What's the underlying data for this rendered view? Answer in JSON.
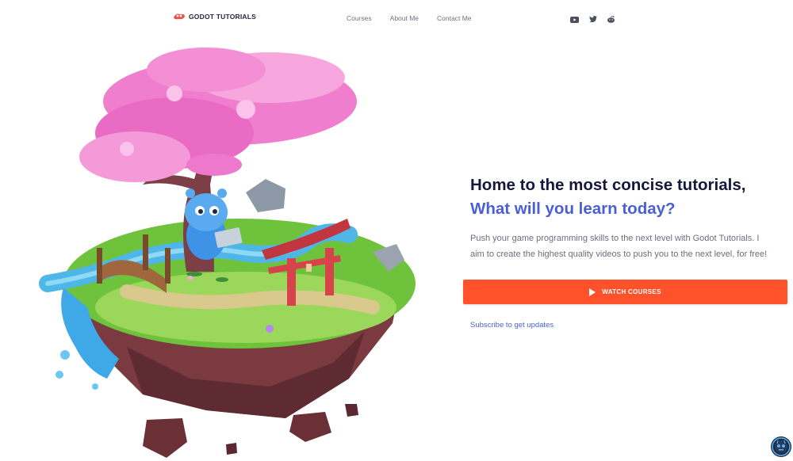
{
  "nav": {
    "brand": "GODOT TUTORIALS",
    "links": [
      "Courses",
      "About Me",
      "Contact Me"
    ],
    "socials": [
      "youtube-icon",
      "twitter-icon",
      "reddit-icon"
    ]
  },
  "hero": {
    "headline": "Home to the most concise tutorials,",
    "subheadline": "What will you learn today?",
    "description": "Push your game programming skills to the next level with Godot Tutorials. I aim to create the highest quality videos to push you to the next level, for free!",
    "cta_label": "WATCH COURSES",
    "subscribe_label": "Subscribe to get updates"
  },
  "colors": {
    "accent": "#ff522b",
    "link": "#4a5fd3",
    "heading": "#15183a"
  }
}
